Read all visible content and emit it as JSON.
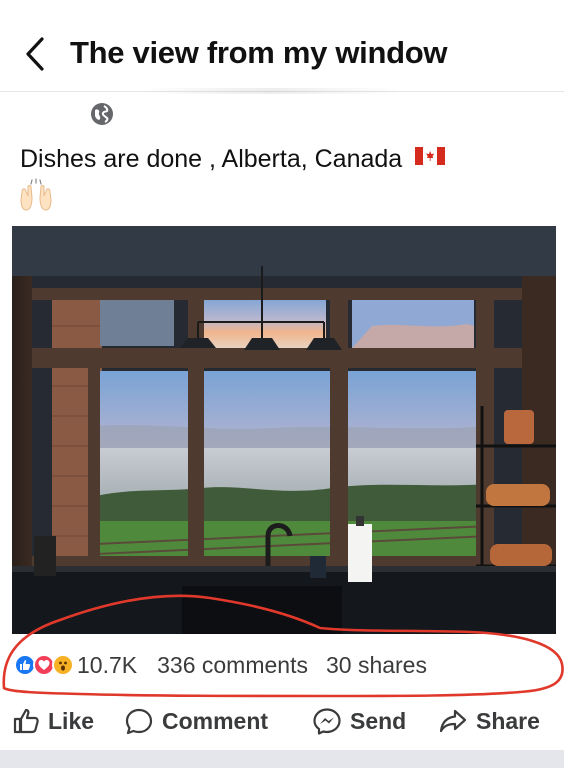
{
  "header": {
    "title": "The view from my window",
    "back_icon": "chevron-left-icon"
  },
  "post": {
    "privacy_icon": "globe-icon",
    "caption": "Dishes are done , Alberta, Canada",
    "caption_emojis": [
      "canada-flag-icon",
      "raising-hands-icon"
    ]
  },
  "reactions": {
    "icons": [
      "like-icon",
      "love-icon",
      "wow-icon"
    ],
    "count": "10.7K",
    "comments": "336 comments",
    "shares": "30 shares"
  },
  "actions": {
    "like": "Like",
    "comment": "Comment",
    "send": "Send",
    "share": "Share"
  },
  "colors": {
    "accent_blue": "#1877f2",
    "love_red": "#f33e58",
    "wow_yellow": "#f7b125",
    "annotation_red": "#e0392b"
  }
}
